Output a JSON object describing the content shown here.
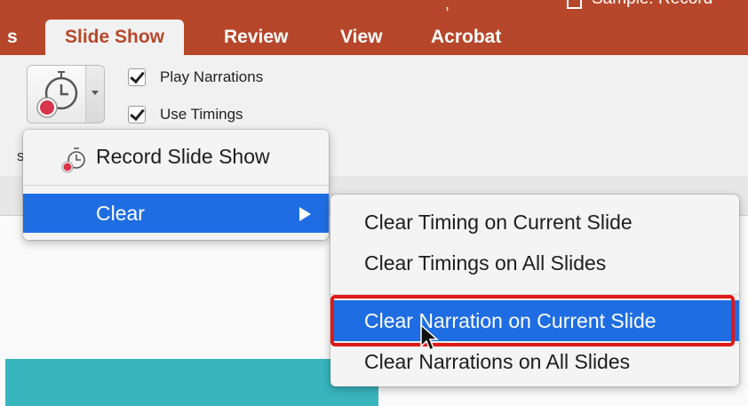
{
  "ribbon": {
    "tabs": [
      {
        "label": "s"
      },
      {
        "label": "Slide Show",
        "active": true
      },
      {
        "label": "Review"
      },
      {
        "label": "View"
      },
      {
        "label": "Acrobat"
      }
    ],
    "title_fragment": "Sample: Record",
    "title_punct": ",",
    "accent_color": "#b7472a"
  },
  "toolbar": {
    "record_button_icon": "record-stopwatch-icon",
    "checkboxes": [
      {
        "label": "Play Narrations",
        "checked": true
      },
      {
        "label": "Use Timings",
        "checked": true
      }
    ],
    "stray_label": "s"
  },
  "record_menu": {
    "items": [
      {
        "label": "Record Slide Show",
        "icon": "record-stopwatch-icon"
      },
      {
        "label": "Clear",
        "highlighted": true,
        "has_submenu": true
      }
    ]
  },
  "clear_submenu": {
    "items": [
      {
        "label": "Clear Timing on Current Slide"
      },
      {
        "label": "Clear Timings on All Slides"
      },
      {
        "label": "Clear Narration on Current Slide",
        "highlighted": true
      },
      {
        "label": "Clear Narrations on All Slides"
      }
    ],
    "highlight_color": "#1f6de2",
    "annotation_color": "#e01818"
  }
}
